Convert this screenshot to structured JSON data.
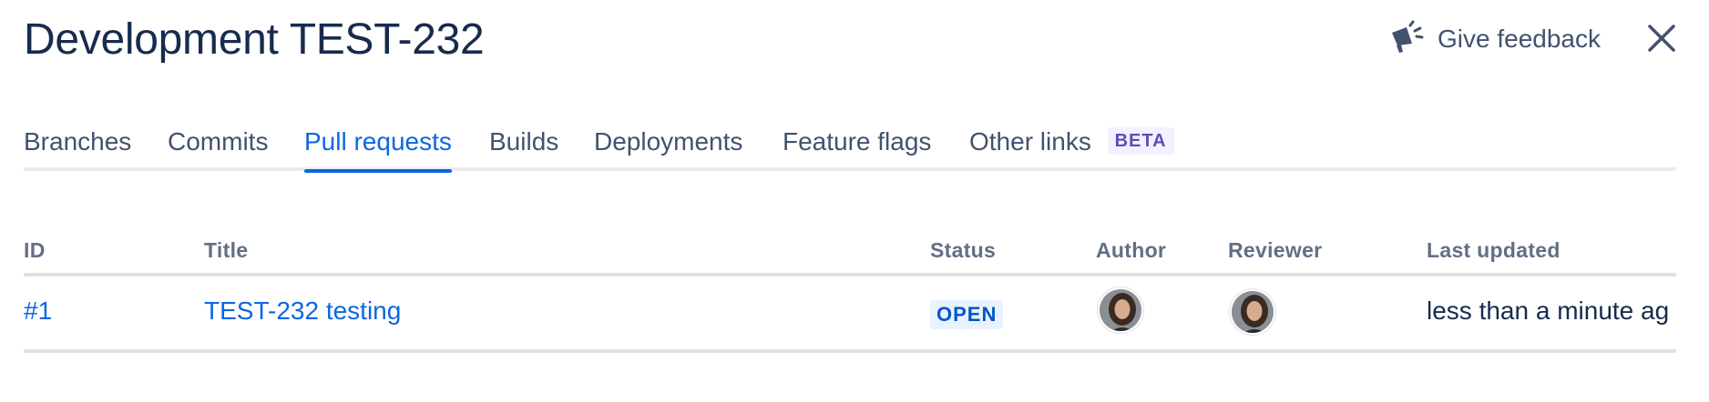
{
  "header": {
    "title": "Development TEST-232",
    "feedback_label": "Give feedback"
  },
  "tabs": [
    {
      "label": "Branches"
    },
    {
      "label": "Commits"
    },
    {
      "label": "Pull requests",
      "active": true
    },
    {
      "label": "Builds"
    },
    {
      "label": "Deployments"
    },
    {
      "label": "Feature flags"
    },
    {
      "label": "Other links",
      "badge": "BETA"
    }
  ],
  "table": {
    "columns": [
      "ID",
      "Title",
      "Status",
      "Author",
      "Reviewer",
      "Last updated"
    ],
    "rows": [
      {
        "id": "#1",
        "title": "TEST-232 testing",
        "status": "OPEN",
        "author_avatar": "avatar",
        "reviewer_avatar": "avatar",
        "last_updated": "less than a minute ag"
      }
    ]
  },
  "colors": {
    "accent": "#0c66e4",
    "text": "#172b4d",
    "subtle": "#42526e",
    "beta_bg": "#f3f0ff",
    "beta_text": "#5e4db2",
    "status_bg": "#e9f2ff",
    "status_text": "#0055cc"
  },
  "icons": {
    "feedback": "megaphone-icon",
    "close": "close-icon"
  }
}
